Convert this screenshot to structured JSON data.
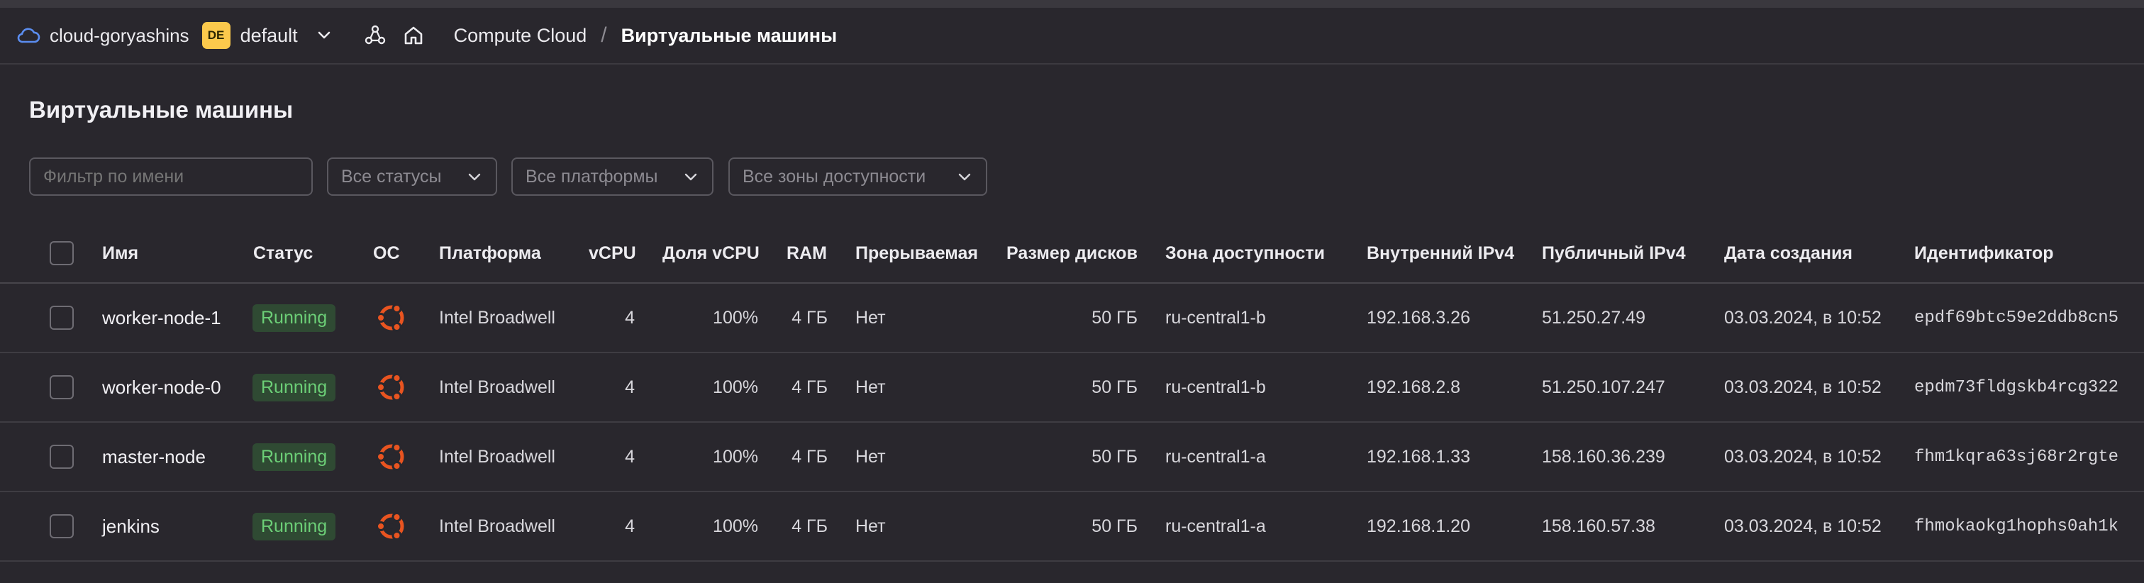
{
  "header": {
    "cloud_name": "cloud-goryashins",
    "folder_badge": "DE",
    "folder_name": "default",
    "breadcrumb_service": "Compute Cloud",
    "breadcrumb_separator": "/",
    "breadcrumb_current": "Виртуальные машины"
  },
  "page": {
    "title": "Виртуальные машины"
  },
  "filters": {
    "name_placeholder": "Фильтр по имени",
    "status_select": "Все статусы",
    "platform_select": "Все платформы",
    "zone_select": "Все зоны доступности"
  },
  "table": {
    "columns": {
      "name": "Имя",
      "status": "Статус",
      "os": "ОС",
      "platform": "Платформа",
      "vcpu": "vCPU",
      "vcpu_share": "Доля vCPU",
      "ram": "RAM",
      "preemptible": "Прерываемая",
      "disk_size": "Размер дисков",
      "zone": "Зона доступности",
      "internal_ip": "Внутренний IPv4",
      "public_ip": "Публичный IPv4",
      "created": "Дата создания",
      "id": "Идентификатор"
    },
    "rows": [
      {
        "name": "worker-node-1",
        "status": "Running",
        "os_icon": "ubuntu-icon",
        "platform": "Intel Broadwell",
        "vcpu": "4",
        "vcpu_share": "100%",
        "ram": "4 ГБ",
        "preemptible": "Нет",
        "disk_size": "50 ГБ",
        "zone": "ru-central1-b",
        "internal_ip": "192.168.3.26",
        "public_ip": "51.250.27.49",
        "created": "03.03.2024, в 10:52",
        "id": "epdf69btc59e2ddb8cn5"
      },
      {
        "name": "worker-node-0",
        "status": "Running",
        "os_icon": "ubuntu-icon",
        "platform": "Intel Broadwell",
        "vcpu": "4",
        "vcpu_share": "100%",
        "ram": "4 ГБ",
        "preemptible": "Нет",
        "disk_size": "50 ГБ",
        "zone": "ru-central1-b",
        "internal_ip": "192.168.2.8",
        "public_ip": "51.250.107.247",
        "created": "03.03.2024, в 10:52",
        "id": "epdm73fldgskb4rcg322"
      },
      {
        "name": "master-node",
        "status": "Running",
        "os_icon": "ubuntu-icon",
        "platform": "Intel Broadwell",
        "vcpu": "4",
        "vcpu_share": "100%",
        "ram": "4 ГБ",
        "preemptible": "Нет",
        "disk_size": "50 ГБ",
        "zone": "ru-central1-a",
        "internal_ip": "192.168.1.33",
        "public_ip": "158.160.36.239",
        "created": "03.03.2024, в 10:52",
        "id": "fhm1kqra63sj68r2rgte"
      },
      {
        "name": "jenkins",
        "status": "Running",
        "os_icon": "ubuntu-icon",
        "platform": "Intel Broadwell",
        "vcpu": "4",
        "vcpu_share": "100%",
        "ram": "4 ГБ",
        "preemptible": "Нет",
        "disk_size": "50 ГБ",
        "zone": "ru-central1-a",
        "internal_ip": "192.168.1.20",
        "public_ip": "158.160.57.38",
        "created": "03.03.2024, в 10:52",
        "id": "fhmokaokg1hophs0ah1k"
      }
    ]
  },
  "colors": {
    "background": "#29272d",
    "status_running_bg": "#2f4a33",
    "status_running_text": "#6ccf77",
    "ubuntu_orange": "#e95420",
    "folder_badge": "#fbc94c",
    "cloud_icon": "#5b8def"
  }
}
